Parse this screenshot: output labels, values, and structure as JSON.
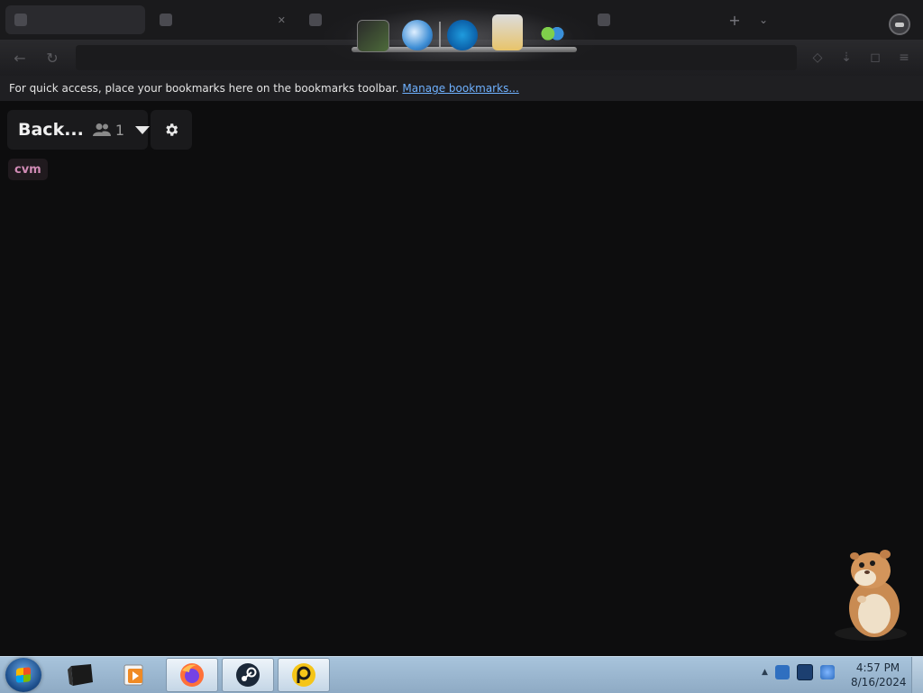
{
  "browser": {
    "tabs": [
      {
        "label": "",
        "active": true
      },
      {
        "label": "",
        "active": false
      },
      {
        "label": "",
        "active": false
      },
      {
        "label": "",
        "active": false
      }
    ],
    "bookmarks_toolbar": {
      "message": "For quick access, place your bookmarks here on the bookmarks toolbar.",
      "link_label": "Manage bookmarks..."
    }
  },
  "dock": {
    "icons": [
      "terminal-cube-icon",
      "globe-download-icon",
      "internet-explorer-icon",
      "mail-tray-icon",
      "messenger-people-icon"
    ]
  },
  "room": {
    "name": "Back...",
    "user_count": "1"
  },
  "tag": {
    "label": "cvm"
  },
  "taskbar": {
    "items": [
      "start-orb",
      "monitor-app",
      "media-player",
      "firefox",
      "steam",
      "parsec-like-app"
    ],
    "clock": {
      "time": "4:57 PM",
      "date": "8/16/2024"
    }
  },
  "colors": {
    "page_bg": "#0d0d0e",
    "tag_text": "#d08bb5",
    "link": "#6fb1ff",
    "taskbar": "#a8c4dc"
  }
}
